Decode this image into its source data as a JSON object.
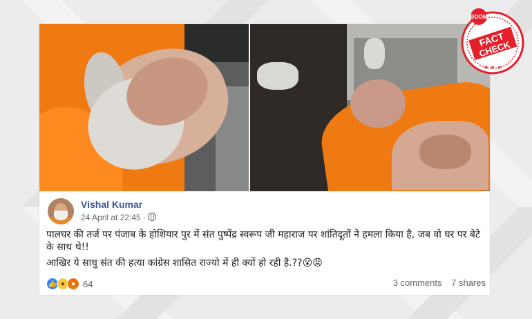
{
  "post": {
    "author": "Vishal Kumar",
    "timestamp": "24 April at 22:45",
    "audience_icon": "globe-icon",
    "paragraph1": "पालघर की तर्ज पर पंजाब के होशियार पुर में संत पुष्पेंद्र स्वरूप जी महाराज पर शांतिदूतों ने हमला किया है, जब वो घर पर बेटे के साथ थे!!",
    "paragraph2": "आखिर ये साधु संत की हत्या कांग्रेस शासित राज्यो में ही क्यों हो रही है.??😮😡",
    "reactions": {
      "icons": [
        "like-icon",
        "sad-icon",
        "angry-icon"
      ],
      "count": "64"
    },
    "comments": "3 comments",
    "shares": "7 shares"
  },
  "stamp": {
    "brand": "BOOM",
    "line1": "FACT",
    "line2": "CHECK",
    "color": "#e4202a"
  },
  "colors": {
    "link": "#385898",
    "meta": "#606770",
    "robe": "#f07a12"
  }
}
